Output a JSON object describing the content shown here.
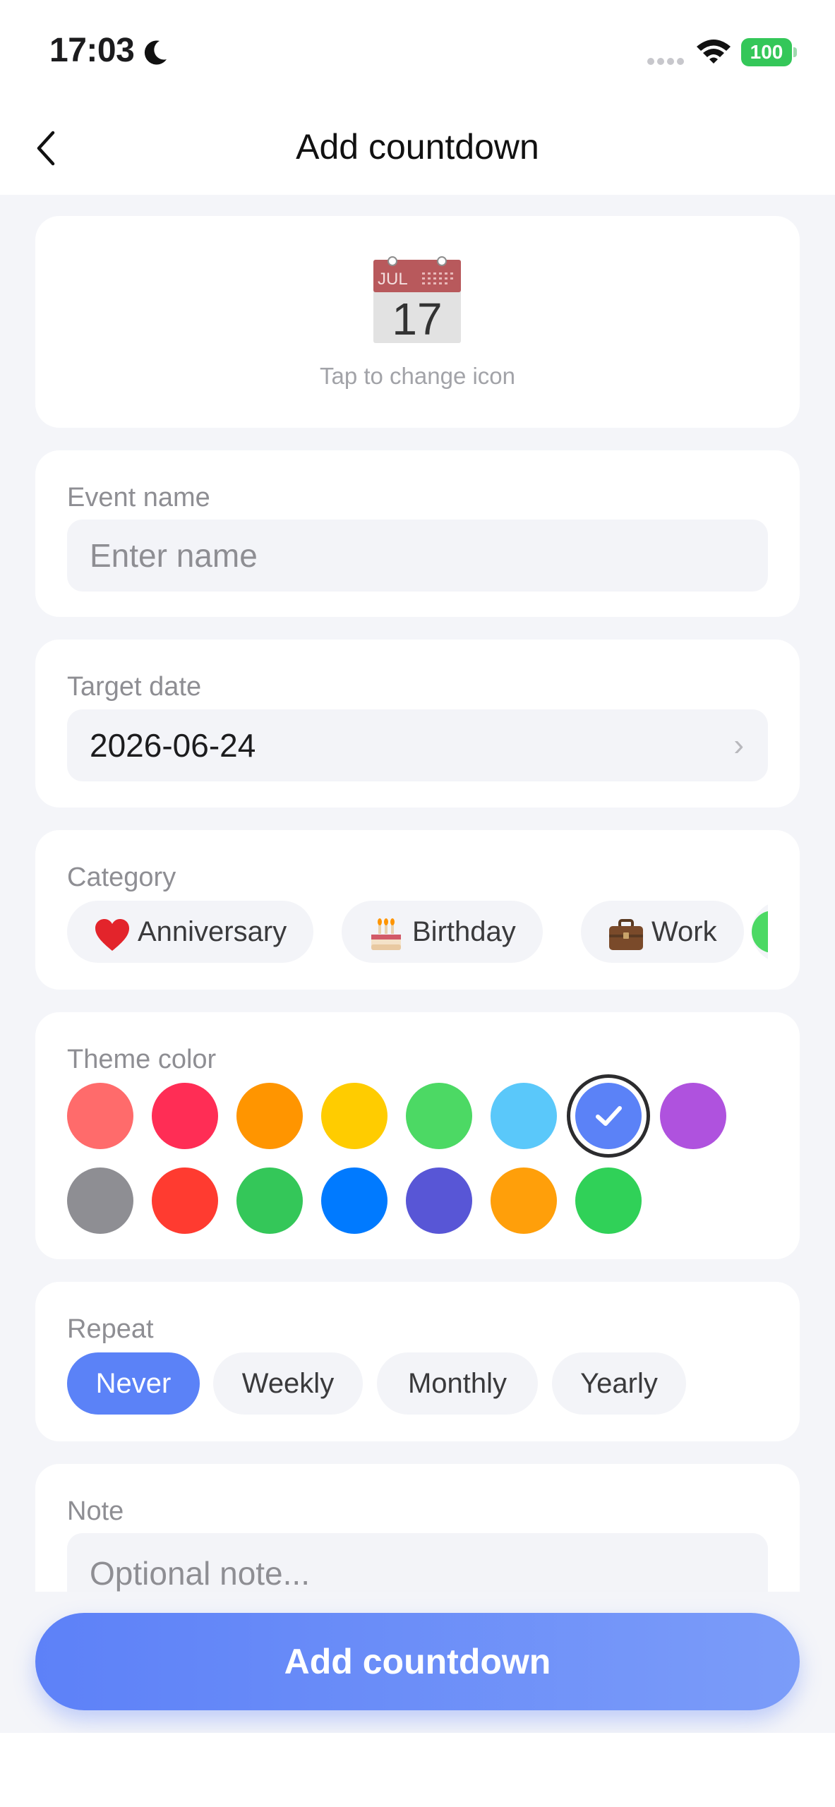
{
  "status_bar": {
    "time": "17:03",
    "battery": "100",
    "icons": [
      "moon-icon",
      "signal-icon",
      "wifi-icon",
      "battery-icon"
    ]
  },
  "nav": {
    "title": "Add countdown",
    "back_icon": "chevron-left-icon"
  },
  "icon_picker": {
    "calendar_month": "JUL",
    "calendar_day": "17",
    "hint": "Tap to change icon"
  },
  "event_name": {
    "label": "Event name",
    "placeholder": "Enter name",
    "value": ""
  },
  "target_date": {
    "label": "Target date",
    "value": "2026-06-24",
    "chevron": "›"
  },
  "category": {
    "label": "Category",
    "items": [
      {
        "label": "Anniversary",
        "icon": "heart-icon",
        "emoji": "❤"
      },
      {
        "label": "Birthday",
        "icon": "cake-icon",
        "emoji": "🎂"
      },
      {
        "label": "Work",
        "icon": "briefcase-icon",
        "emoji": "💼"
      }
    ]
  },
  "theme_color": {
    "label": "Theme color",
    "selected": "#5b82f7",
    "colors": [
      "#ff6b6b",
      "#ff2d55",
      "#ff9500",
      "#ffcc00",
      "#4cd964",
      "#5ac8fa",
      "#5b82f7",
      "#af52de",
      "#8e8e93",
      "#ff3b30",
      "#34c759",
      "#007aff",
      "#5856d6",
      "#ff9f0a",
      "#30d158"
    ]
  },
  "repeat": {
    "label": "Repeat",
    "options": [
      "Never",
      "Weekly",
      "Monthly",
      "Yearly"
    ],
    "selected": "Never"
  },
  "note": {
    "label": "Note",
    "placeholder": "Optional note..."
  },
  "submit": {
    "label": "Add countdown"
  }
}
